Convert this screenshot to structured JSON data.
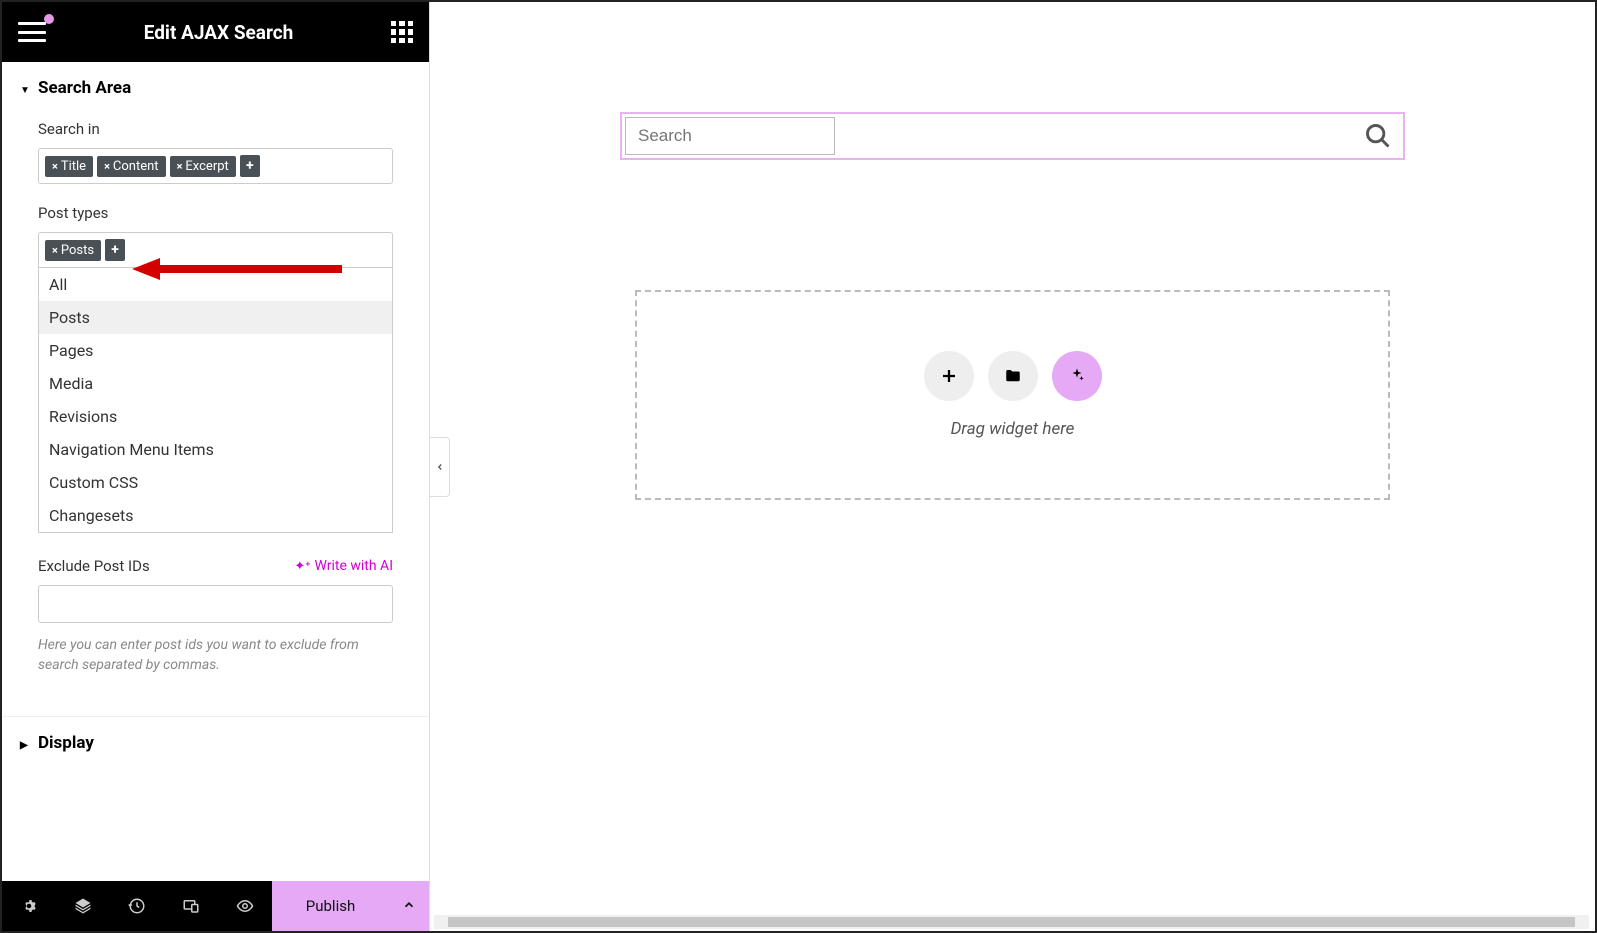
{
  "header": {
    "title": "Edit AJAX Search"
  },
  "sections": {
    "search_area": {
      "title": "Search Area"
    },
    "display": {
      "title": "Display"
    }
  },
  "search_in": {
    "label": "Search in",
    "tags": [
      "Title",
      "Content",
      "Excerpt"
    ]
  },
  "post_types": {
    "label": "Post types",
    "selected": [
      "Posts"
    ],
    "options": [
      "All",
      "Posts",
      "Pages",
      "Media",
      "Revisions",
      "Navigation Menu Items",
      "Custom CSS",
      "Changesets"
    ]
  },
  "exclude": {
    "label": "Exclude Post IDs",
    "write_ai": "Write with AI",
    "help": "Here you can enter post ids you want to exclude from search separated by commas."
  },
  "bottom": {
    "publish": "Publish"
  },
  "canvas": {
    "search_placeholder": "Search",
    "drop_text": "Drag widget here"
  }
}
